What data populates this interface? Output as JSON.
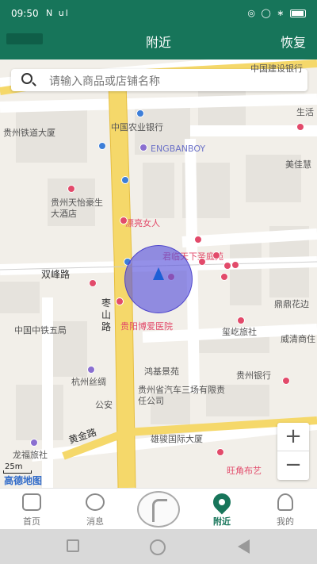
{
  "status": {
    "time": "09:50",
    "left_icons": "N ul",
    "right_icons": "◎ ◯ ∗"
  },
  "header": {
    "title": "附近",
    "action": "恢复"
  },
  "search": {
    "placeholder": "请输入商品或店铺名称"
  },
  "map": {
    "labels": [
      "中国建设银行",
      "贵州铁道大厦",
      "中国农业银行",
      "ENGBANBOY",
      "生活",
      "美佳慧",
      "贵州天怡豪生大酒店",
      "漂亮女人",
      "君临天下圣庭苑",
      "双峰路",
      "中国中铁五局",
      "枣山路",
      "贵阳博爱医院",
      "玺屹旅社",
      "威清商住",
      "鼎鼎花边",
      "杭州丝绸",
      "鸿基景苑",
      "贵州银行",
      "贵州省汽车三场有限责任公司",
      "公安",
      "黄金路",
      "雄骏国际大厦",
      "龙福旅社",
      "旺角布艺"
    ],
    "scale": "25m",
    "brand": "高德地图"
  },
  "zoom": {
    "in": "+",
    "out": "−"
  },
  "tabs": [
    {
      "label": "首页",
      "icon": "home-icon"
    },
    {
      "label": "消息",
      "icon": "message-icon"
    },
    {
      "label": "",
      "icon": "logo-icon"
    },
    {
      "label": "附近",
      "icon": "location-pin-icon"
    },
    {
      "label": "我的",
      "icon": "user-icon"
    }
  ],
  "colors": {
    "brand": "#17755a",
    "locator": "#5a55dc",
    "poi_red": "#e24a6a"
  }
}
